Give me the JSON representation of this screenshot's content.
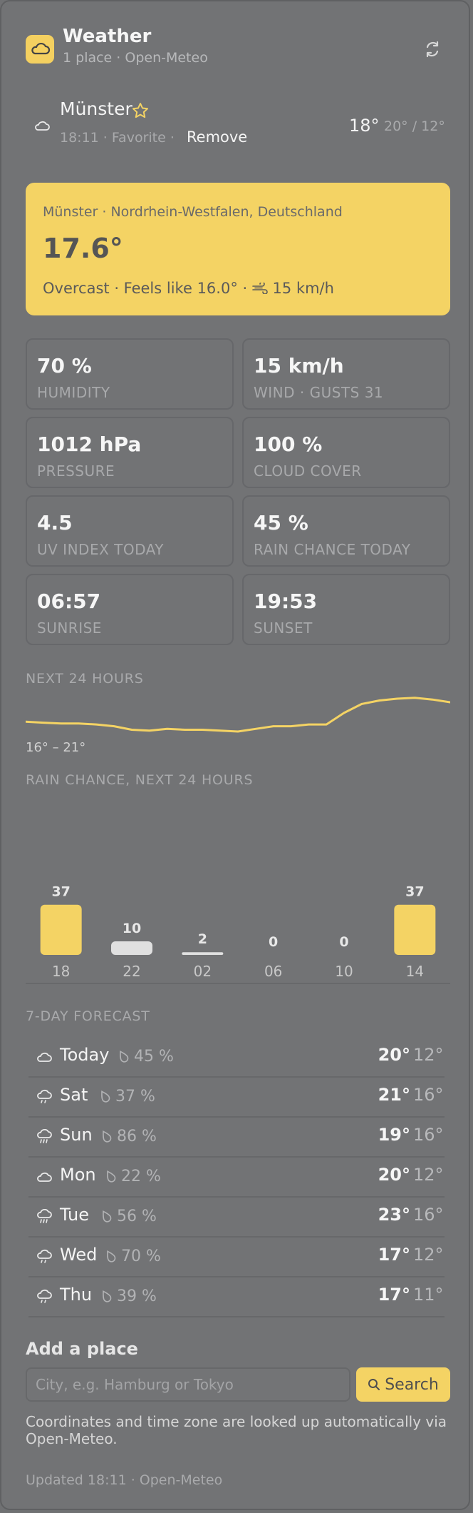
{
  "header": {
    "title": "Weather",
    "subtitle": "1 place · Open-Meteo",
    "icons": {
      "app": "cloud-icon",
      "refresh": "refresh-icon"
    }
  },
  "saved_place": {
    "name": "Münster",
    "meta": "18:11 · Favorite ·",
    "remove_label": "Remove",
    "temp": "18°",
    "hilo": "20° / 12°",
    "icons": {
      "weather": "cloud-icon",
      "favorite": "star-icon"
    }
  },
  "current": {
    "location": "Münster · Nordrhein-Westfalen, Deutschland",
    "temp": "17.6°",
    "description": "Overcast · Feels like 16.0° ·",
    "wind": "15 km/h",
    "icons": {
      "wind": "wind-icon"
    }
  },
  "stats": [
    {
      "value": "70 %",
      "label": "HUMIDITY"
    },
    {
      "value": "15 km/h",
      "label": "WIND · GUSTS 31"
    },
    {
      "value": "1012 hPa",
      "label": "PRESSURE"
    },
    {
      "value": "100 %",
      "label": "CLOUD COVER"
    },
    {
      "value": "4.5",
      "label": "UV INDEX TODAY"
    },
    {
      "value": "45 %",
      "label": "RAIN CHANCE TODAY"
    },
    {
      "value": "06:57",
      "label": "SUNRISE"
    },
    {
      "value": "19:53",
      "label": "SUNSET"
    }
  ],
  "hourly": {
    "label": "NEXT 24 HOURS",
    "range": "16° – 21°"
  },
  "rain": {
    "label": "RAIN CHANCE, NEXT 24 HOURS"
  },
  "chart_data": [
    {
      "type": "line",
      "title": "NEXT 24 HOURS",
      "x": [
        0,
        1,
        2,
        3,
        4,
        5,
        6,
        7,
        8,
        9,
        10,
        11,
        12,
        13,
        14,
        15,
        16,
        17,
        18,
        19,
        20,
        21,
        22,
        23,
        24
      ],
      "values": [
        18.0,
        17.9,
        17.8,
        17.8,
        17.7,
        17.5,
        17.1,
        17.0,
        17.2,
        17.1,
        17.1,
        17.0,
        16.9,
        17.2,
        17.5,
        17.5,
        17.7,
        17.7,
        19.0,
        20.0,
        20.4,
        20.6,
        20.7,
        20.5,
        20.2
      ],
      "ylim": [
        16.5,
        21.0
      ],
      "annotation": "16° – 21°",
      "color": "#f4d364",
      "grid": false,
      "legend": "none"
    },
    {
      "type": "bar",
      "title": "RAIN CHANCE, NEXT 24 HOURS",
      "categories": [
        "18",
        "22",
        "02",
        "06",
        "10",
        "14"
      ],
      "values": [
        37,
        10,
        2,
        0,
        0,
        37
      ],
      "ylim": [
        0,
        100
      ],
      "colors": {
        "high": "#f4d364",
        "low": "#e0e0e0"
      },
      "grid": false,
      "legend": "none"
    }
  ],
  "forecast": {
    "label": "7-DAY FORECAST",
    "days": [
      {
        "day": "Today",
        "rain": "45 %",
        "hi": "20°",
        "lo": "12°",
        "icon": "cloud-icon"
      },
      {
        "day": "Sat",
        "rain": "37 %",
        "hi": "21°",
        "lo": "16°",
        "icon": "cloud-rain-icon"
      },
      {
        "day": "Sun",
        "rain": "86 %",
        "hi": "19°",
        "lo": "16°",
        "icon": "cloud-rain-heavy-icon"
      },
      {
        "day": "Mon",
        "rain": "22 %",
        "hi": "20°",
        "lo": "12°",
        "icon": "cloud-icon"
      },
      {
        "day": "Tue",
        "rain": "56 %",
        "hi": "23°",
        "lo": "16°",
        "icon": "cloud-rain-heavy-icon"
      },
      {
        "day": "Wed",
        "rain": "70 %",
        "hi": "17°",
        "lo": "12°",
        "icon": "cloud-rain-icon"
      },
      {
        "day": "Thu",
        "rain": "39 %",
        "hi": "17°",
        "lo": "11°",
        "icon": "cloud-rain-icon"
      }
    ]
  },
  "add_place": {
    "title": "Add a place",
    "placeholder": "City, e.g. Hamburg or Tokyo",
    "value": "",
    "button_label": "Search",
    "note": "Coordinates and time zone are looked up automatically via Open-Meteo.",
    "icons": {
      "search": "search-icon"
    }
  },
  "footer": {
    "updated": "Updated 18:11 · Open-Meteo"
  },
  "colors": {
    "accent": "#f4d364",
    "background": "#727375",
    "border": "#66676a"
  }
}
